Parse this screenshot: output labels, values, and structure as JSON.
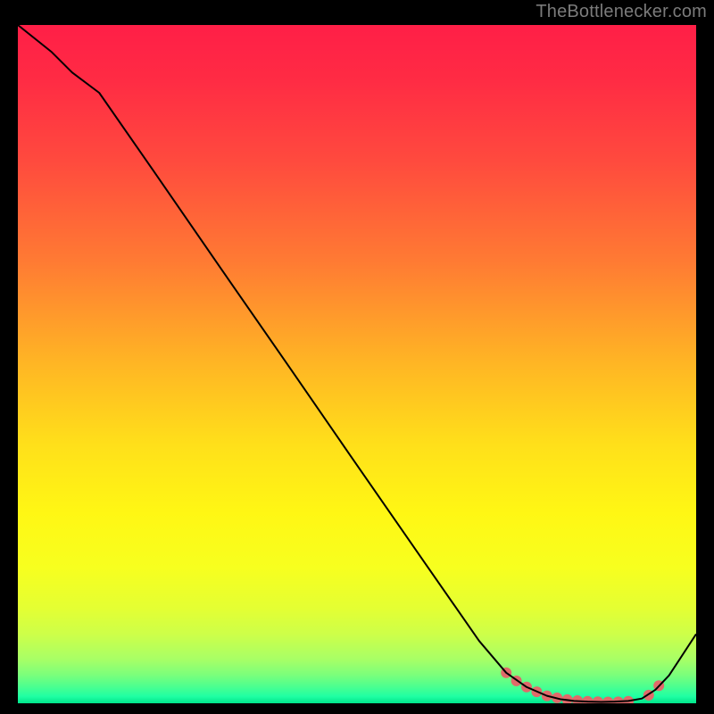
{
  "attribution": "TheBottlenecker.com",
  "chart_data": {
    "type": "line",
    "title": "",
    "xlabel": "",
    "ylabel": "",
    "xlim": [
      0,
      100
    ],
    "ylim": [
      0,
      100
    ],
    "grid": false,
    "background_gradient": {
      "stops": [
        {
          "offset": 0.0,
          "color": "#ff1f47"
        },
        {
          "offset": 0.08,
          "color": "#ff2b44"
        },
        {
          "offset": 0.2,
          "color": "#ff4a3e"
        },
        {
          "offset": 0.35,
          "color": "#ff7b33"
        },
        {
          "offset": 0.5,
          "color": "#ffb624"
        },
        {
          "offset": 0.62,
          "color": "#ffe01a"
        },
        {
          "offset": 0.72,
          "color": "#fff714"
        },
        {
          "offset": 0.8,
          "color": "#f7ff1f"
        },
        {
          "offset": 0.86,
          "color": "#e4ff33"
        },
        {
          "offset": 0.9,
          "color": "#ccff4a"
        },
        {
          "offset": 0.935,
          "color": "#a8ff66"
        },
        {
          "offset": 0.958,
          "color": "#7bff7b"
        },
        {
          "offset": 0.975,
          "color": "#4dff8f"
        },
        {
          "offset": 0.99,
          "color": "#1fffa3"
        },
        {
          "offset": 1.0,
          "color": "#00e58a"
        }
      ]
    },
    "series": [
      {
        "name": "bottleneck-curve",
        "stroke": "#000000",
        "stroke_width": 2,
        "x": [
          0,
          5,
          8,
          12,
          20,
          30,
          40,
          50,
          60,
          68,
          72,
          75,
          78,
          80,
          82,
          84,
          86,
          88,
          90,
          92,
          94,
          96,
          100
        ],
        "y": [
          100,
          96,
          93,
          90,
          78.5,
          64,
          49.6,
          35.1,
          20.7,
          9.2,
          4.5,
          2.4,
          1.1,
          0.6,
          0.35,
          0.25,
          0.2,
          0.25,
          0.35,
          0.7,
          2.0,
          4.1,
          10.2
        ]
      }
    ],
    "markers": {
      "name": "highlight-dots",
      "color": "#e06a6a",
      "radius": 6,
      "x": [
        72,
        73.5,
        75,
        76.5,
        78,
        79.5,
        81,
        82.5,
        84,
        85.5,
        87,
        88.5,
        90,
        93,
        94.5
      ],
      "y": [
        4.5,
        3.3,
        2.4,
        1.7,
        1.1,
        0.8,
        0.55,
        0.4,
        0.3,
        0.23,
        0.2,
        0.22,
        0.3,
        1.2,
        2.6
      ]
    }
  }
}
